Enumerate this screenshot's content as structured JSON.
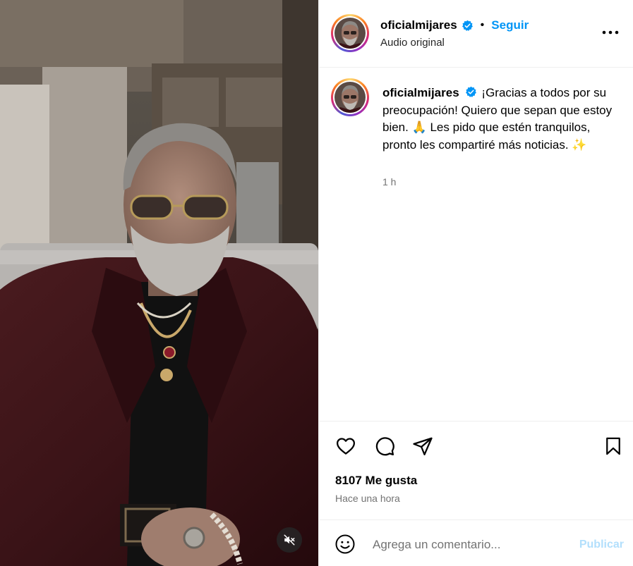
{
  "post": {
    "username": "oficialmijares",
    "follow_label": "Seguir",
    "dot": "•",
    "audio_label": "Audio original",
    "caption": "¡Gracias a todos por su preocupación! Quiero que sepan que estoy bien. 🙏 Les pido que estén tranquilos, pronto les compartiré más noticias. ✨",
    "caption_time": "1 h",
    "likes": "8107 Me gusta",
    "posted_ago": "Hace una hora"
  },
  "comment_box": {
    "placeholder": "Agrega un comentario...",
    "publish_label": "Publicar"
  },
  "icons": {
    "more": "more-options-icon",
    "like": "heart-icon",
    "comment": "comment-icon",
    "share": "send-icon",
    "save": "bookmark-icon",
    "mute": "muted-speaker-icon",
    "emoji": "emoji-icon",
    "verified": "verified-badge-icon"
  },
  "colors": {
    "accent": "#0095f6",
    "publish_disabled": "#b2dffc",
    "secondary_text": "#737373",
    "verified": "#0095f6"
  }
}
